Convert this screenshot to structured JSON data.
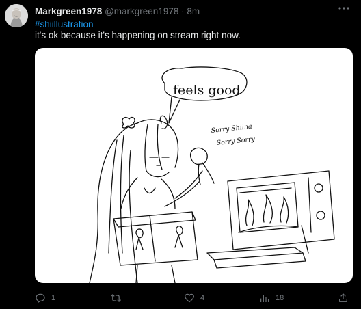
{
  "tweet": {
    "display_name": "Markgreen1978",
    "handle": "@markgreen1978",
    "separator": "·",
    "time": "8m",
    "more_icon": "more-horizontal-icon",
    "hashtag": "#shiillustration",
    "text": "it's ok because it's happening on stream right now.",
    "media": {
      "speech_bubble_text": "feels good",
      "caption_line1": "Sorry Shiina",
      "caption_line2": "Sorry Sorry"
    }
  },
  "actions": {
    "reply_icon": "reply-icon",
    "reply_count": "1",
    "retweet_icon": "retweet-icon",
    "retweet_count": "",
    "like_icon": "heart-icon",
    "like_count": "4",
    "views_icon": "views-icon",
    "views_count": "18",
    "share_icon": "share-icon"
  },
  "colors": {
    "background": "#000000",
    "text_primary": "#e7e9ea",
    "text_secondary": "#71767b",
    "link": "#1d9bf0"
  }
}
